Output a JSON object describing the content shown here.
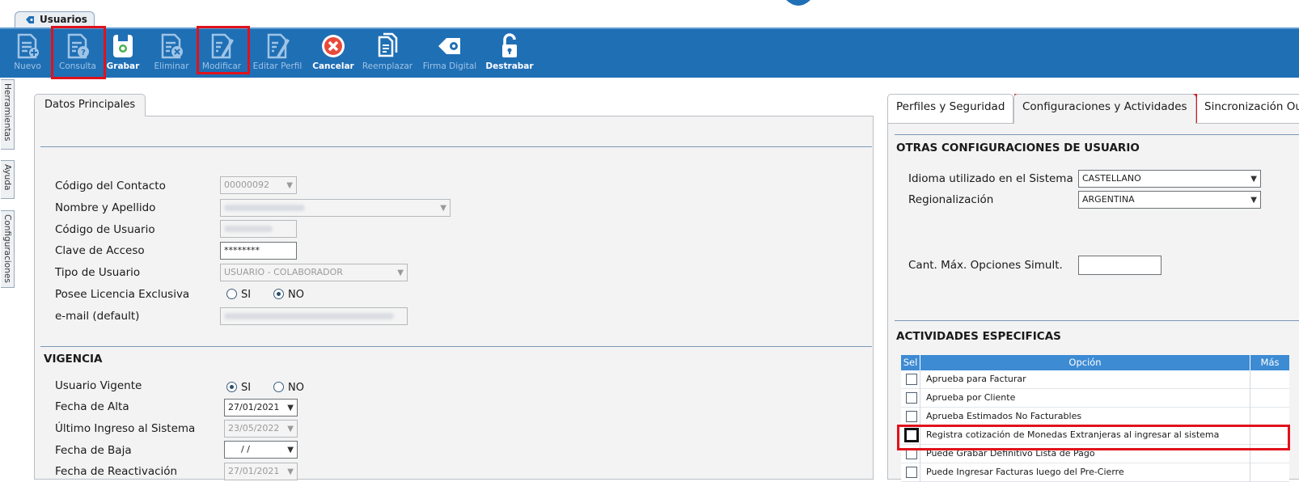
{
  "window_tab": {
    "label": "Usuarios",
    "icon": "tag-icon"
  },
  "toolbar": {
    "buttons": [
      {
        "label": "Nuevo",
        "icon": "new-document-icon",
        "enabled": false
      },
      {
        "label": "Consulta",
        "icon": "query-document-icon",
        "enabled": false
      },
      {
        "label": "Grabar",
        "icon": "save-disk-icon",
        "enabled": true
      },
      {
        "label": "Eliminar",
        "icon": "delete-document-icon",
        "enabled": false
      },
      {
        "label": "Modificar",
        "icon": "edit-document-icon",
        "enabled": false
      },
      {
        "label": "Editar Perfil",
        "icon": "edit-profile-icon",
        "enabled": false
      },
      {
        "label": "Cancelar",
        "icon": "cancel-icon",
        "enabled": true
      },
      {
        "label": "Reemplazar",
        "icon": "replace-document-icon",
        "enabled": false
      },
      {
        "label": "Firma Digital",
        "icon": "digital-signature-icon",
        "enabled": false
      },
      {
        "label": "Destrabar",
        "icon": "unlock-icon",
        "enabled": true
      }
    ],
    "colors": {
      "background": "#1f6fb5",
      "highlight": "#e0121b"
    }
  },
  "side_tabs": [
    "Herramientas",
    "Ayuda",
    "Configuraciones"
  ],
  "left": {
    "tab": "Datos Principales",
    "fields": {
      "codigo_contacto": {
        "label": "Código del Contacto",
        "value": "00000092"
      },
      "nombre": {
        "label": "Nombre y Apellido"
      },
      "codigo_usuario": {
        "label": "Código de Usuario"
      },
      "clave": {
        "label": "Clave de Acceso",
        "value": "********"
      },
      "tipo": {
        "label": "Tipo de Usuario",
        "value": "USUARIO - COLABORADOR"
      },
      "licencia": {
        "label": "Posee Licencia Exclusiva",
        "opt_si": "SI",
        "opt_no": "NO",
        "selected": "NO"
      },
      "email": {
        "label": "e-mail (default)"
      }
    },
    "vigencia": {
      "title": "VIGENCIA",
      "usuario_vigente": {
        "label": "Usuario Vigente",
        "opt_si": "SI",
        "opt_no": "NO",
        "selected": "SI"
      },
      "fecha_alta": {
        "label": "Fecha de Alta",
        "value": "27/01/2021"
      },
      "ultimo_ingreso": {
        "label": "Último Ingreso al Sistema",
        "value": "23/05/2022"
      },
      "fecha_baja": {
        "label": "Fecha de Baja",
        "value": " /  /"
      },
      "fecha_reactivacion": {
        "label": "Fecha de Reactivación",
        "value": "27/01/2021"
      }
    }
  },
  "right": {
    "tabs": [
      "Perfiles y Seguridad",
      "Configuraciones y Actividades",
      "Sincronización Ou"
    ],
    "active_tab": "Configuraciones y Actividades",
    "otras": {
      "title": "OTRAS CONFIGURACIONES DE USUARIO",
      "idioma": {
        "label": "Idioma utilizado en el Sistema",
        "value": "CASTELLANO"
      },
      "regionalizacion": {
        "label": "Regionalización",
        "value": "ARGENTINA"
      },
      "cant_max": {
        "label": "Cant. Máx. Opciones Simult.",
        "value": ""
      }
    },
    "actividades": {
      "title": "ACTIVIDADES ESPECIFICAS",
      "columns": {
        "sel": "Sel",
        "opcion": "Opción",
        "mas": "Más"
      },
      "rows": [
        "Aprueba para Facturar",
        "Aprueba por Cliente",
        "Aprueba Estimados No Facturables",
        "Registra cotización de Monedas Extranjeras al ingresar al sistema",
        "Puede Grabar Definitivo Lista de Pago",
        "Puede Ingresar Facturas luego del Pre-Cierre"
      ]
    }
  }
}
